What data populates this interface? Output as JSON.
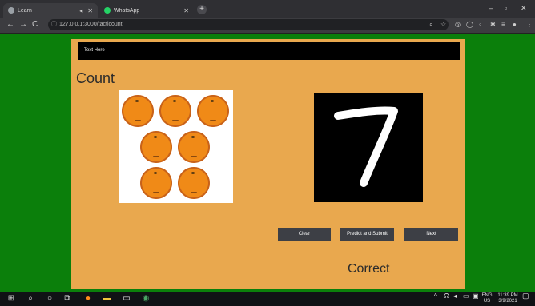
{
  "browser": {
    "tabs": [
      {
        "title": "Learn",
        "active": true
      },
      {
        "title": "WhatsApp",
        "active": false
      }
    ],
    "url": "127.0.0.1:3000/tacticount"
  },
  "page": {
    "header_text": "Text Here",
    "title": "Count",
    "orange_count": 7,
    "drawn_digit": "7",
    "buttons": {
      "clear": "Clear",
      "predict": "Predict and Submit",
      "next": "Next"
    },
    "result": "Correct"
  },
  "taskbar": {
    "language": "ENG",
    "region": "US",
    "time": "11:39 PM",
    "date": "3/9/2021"
  },
  "colors": {
    "background": "#0b7f0b",
    "card": "#e9a84e",
    "orange": "#f08a17",
    "button": "#3d3f45"
  }
}
